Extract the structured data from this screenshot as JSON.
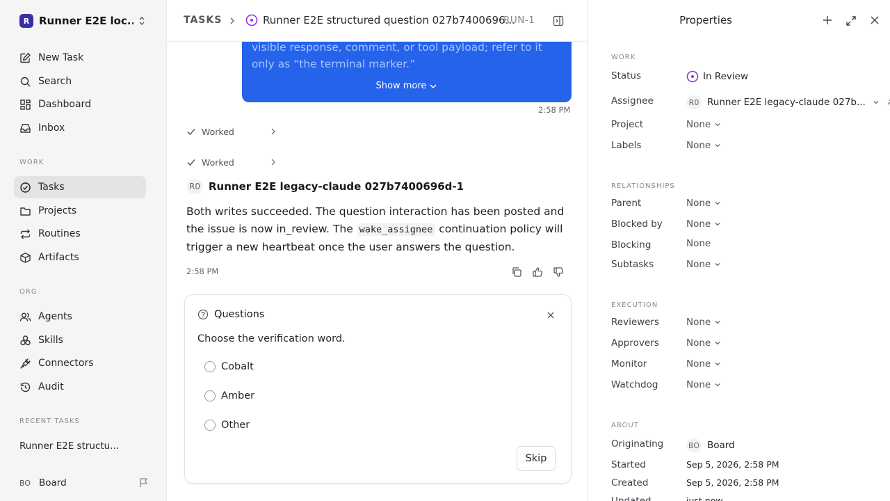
{
  "workspace": {
    "logo_letter": "R",
    "name": "Runner E2E loc..."
  },
  "sidebar": {
    "top_items": [
      {
        "label": "New Task",
        "icon": "edit-icon"
      },
      {
        "label": "Search",
        "icon": "search-icon"
      },
      {
        "label": "Dashboard",
        "icon": "dashboard-icon"
      },
      {
        "label": "Inbox",
        "icon": "inbox-icon"
      }
    ],
    "work_section": "WORK",
    "work_items": [
      {
        "label": "Tasks",
        "icon": "check-circle-icon",
        "active": true
      },
      {
        "label": "Projects",
        "icon": "folder-icon"
      },
      {
        "label": "Routines",
        "icon": "repeat-icon"
      },
      {
        "label": "Artifacts",
        "icon": "box-icon"
      }
    ],
    "org_section": "ORG",
    "org_items": [
      {
        "label": "Agents",
        "icon": "users-icon"
      },
      {
        "label": "Skills",
        "icon": "skills-icon"
      },
      {
        "label": "Connectors",
        "icon": "plug-icon"
      },
      {
        "label": "Audit",
        "icon": "history-icon"
      }
    ],
    "recent_section": "RECENT TASKS",
    "recent_task": "Runner E2E structu...",
    "user": {
      "initials": "BO",
      "name": "Board"
    }
  },
  "topbar": {
    "crumb": "TASKS",
    "title": "Runner E2E structured question 027b7400696...",
    "id": "RUN-1"
  },
  "thread": {
    "user_message": "visible response, comment, or tool payload; refer to it only as “the terminal marker.”",
    "show_more": "Show more",
    "user_message_time": "2:58 PM",
    "worked_label": "Worked",
    "agent": {
      "initials": "R0",
      "name": "Runner E2E legacy-claude 027b7400696d-1",
      "text_before": "Both writes succeeded. The question interaction has been posted and the issue is now in_review. The ",
      "code": "wake_assignee",
      "text_after": " continuation policy will trigger a new heartbeat once the user answers the question.",
      "time": "2:58 PM"
    }
  },
  "question_card": {
    "title": "Questions",
    "prompt": "Choose the verification word.",
    "options": [
      "Cobalt",
      "Amber",
      "Other"
    ],
    "skip_label": "Skip"
  },
  "properties": {
    "title": "Properties",
    "work_section": "WORK",
    "status_label": "Status",
    "status_value": "In Review",
    "assignee_label": "Assignee",
    "assignee_initials": "R0",
    "assignee_value": "Runner E2E legacy-claude 027b...",
    "project_label": "Project",
    "project_value": "None",
    "labels_label": "Labels",
    "labels_value": "None",
    "relationships_section": "RELATIONSHIPS",
    "parent_label": "Parent",
    "parent_value": "None",
    "blocked_by_label": "Blocked by",
    "blocked_by_value": "None",
    "blocking_label": "Blocking",
    "blocking_value": "None",
    "subtasks_label": "Subtasks",
    "subtasks_value": "None",
    "execution_section": "EXECUTION",
    "reviewers_label": "Reviewers",
    "reviewers_value": "None",
    "approvers_label": "Approvers",
    "approvers_value": "None",
    "monitor_label": "Monitor",
    "monitor_value": "None",
    "watchdog_label": "Watchdog",
    "watchdog_value": "None",
    "about_section": "ABOUT",
    "originating_label": "Originating",
    "originating_initials": "BO",
    "originating_value": "Board",
    "started_label": "Started",
    "started_value": "Sep 5, 2026, 2:58 PM",
    "created_label": "Created",
    "created_value": "Sep 5, 2026, 2:58 PM",
    "updated_label": "Updated",
    "updated_value": "just now"
  },
  "colors": {
    "accent_blue": "#2563eb",
    "status_purple": "#9333ea",
    "workspace_logo": "#3730a3"
  }
}
